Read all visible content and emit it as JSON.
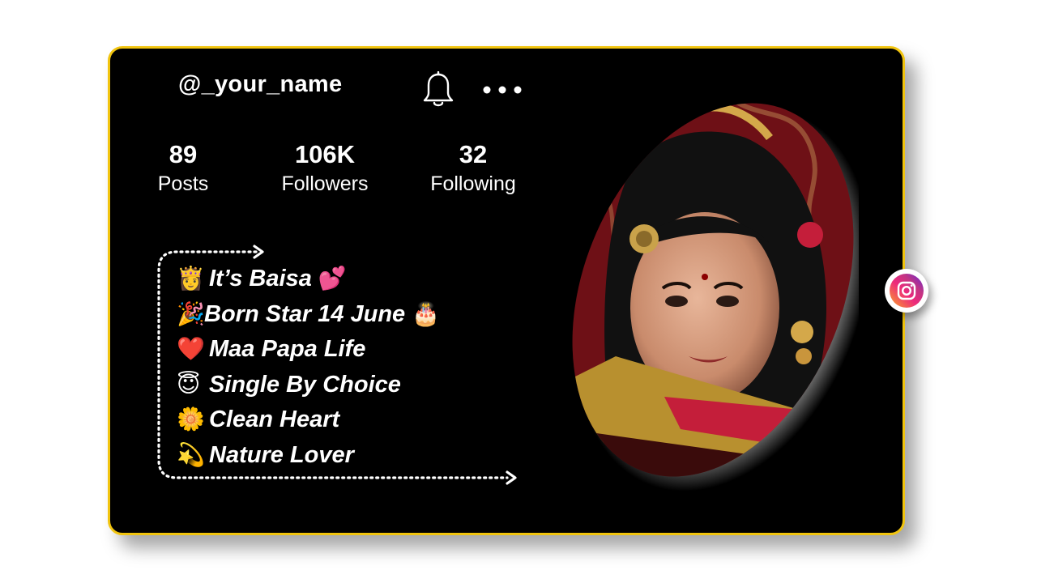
{
  "profile": {
    "username": "@_your_name",
    "stats": [
      {
        "value": "89",
        "label": "Posts"
      },
      {
        "value": "106K",
        "label": "Followers"
      },
      {
        "value": "32",
        "label": "Following"
      }
    ],
    "bio": [
      {
        "emoji": "👸",
        "text": "It’s Baisa",
        "trailing_emoji": "💕"
      },
      {
        "emoji": "🎉",
        "text": "Born Star 14 June",
        "trailing_emoji": "🎂"
      },
      {
        "emoji": "❤️",
        "text": "Maa Papa Life",
        "trailing_emoji": ""
      },
      {
        "emoji": "😇",
        "text": "Single By Choice",
        "trailing_emoji": ""
      },
      {
        "emoji": "🌼",
        "text": "Clean Heart",
        "trailing_emoji": ""
      },
      {
        "emoji": "💫",
        "text": "Nature Lover",
        "trailing_emoji": ""
      }
    ]
  },
  "icons": {
    "bell": "bell-icon",
    "more": "more-options-icon",
    "instagram": "instagram-icon"
  },
  "colors": {
    "card_background": "#000000",
    "card_border": "#f1c40f",
    "text": "#ffffff",
    "instagram_gradient": [
      "#f9a825",
      "#ee2a7b",
      "#c13584",
      "#6228d7"
    ]
  }
}
